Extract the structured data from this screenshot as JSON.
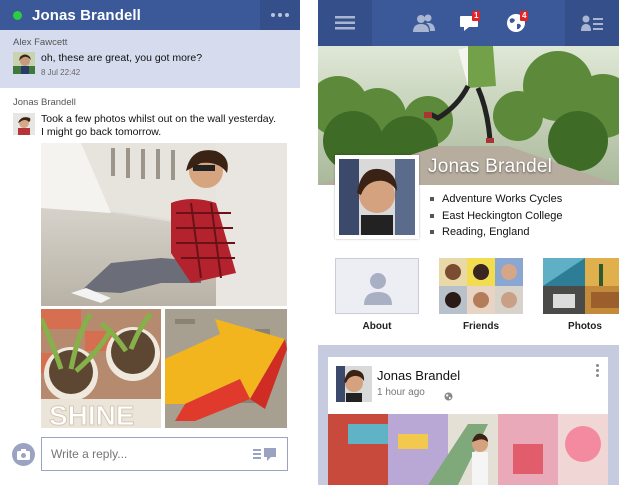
{
  "chat": {
    "title": "Jonas Brandell",
    "messages": [
      {
        "sender": "Alex Fawcett",
        "text": "oh, these are great, you got more?",
        "time": "8 Jul 22:42"
      },
      {
        "sender": "Jonas Brandell",
        "text_line1": "Took a few photos whilst out on the wall yesterday.",
        "text_line2": "I might go back tomorrow."
      }
    ],
    "photo_grid_caption": "SHINE",
    "reply": {
      "placeholder": "Write a reply..."
    }
  },
  "profile": {
    "nav": {
      "messages_badge": "1",
      "notifications_badge": "4"
    },
    "name": "Jonas Brandel",
    "info": [
      "Adventure Works Cycles",
      "East Heckington College",
      "Reading, England"
    ],
    "tiles": [
      {
        "label": "About"
      },
      {
        "label": "Friends"
      },
      {
        "label": "Photos"
      }
    ],
    "post": {
      "author": "Jonas Brandel",
      "time": "1 hour ago"
    }
  },
  "colors": {
    "brand_blue": "#3b5998",
    "highlight_row": "#d7dbee",
    "badge_red": "#e42327",
    "online_green": "#2ecc40"
  },
  "icons": [
    "more-icon",
    "camera-icon",
    "send-icon",
    "menu-icon",
    "friends-icon",
    "messages-icon",
    "notifications-globe-icon",
    "people-icon",
    "globe-icon",
    "post-more-icon",
    "person-silhouette-icon"
  ]
}
